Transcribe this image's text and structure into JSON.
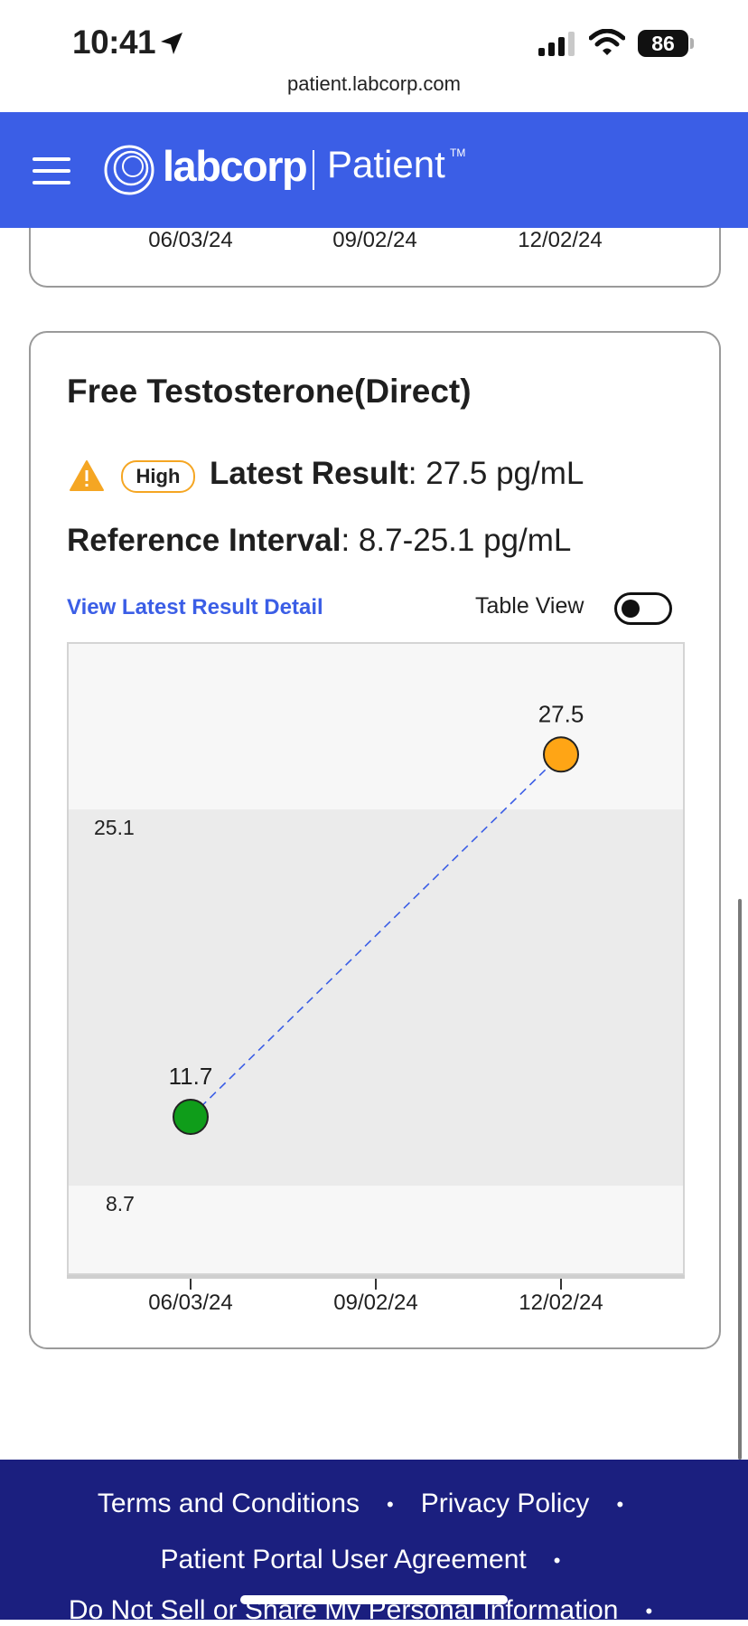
{
  "status_bar": {
    "time": "10:41",
    "battery": "86"
  },
  "browser": {
    "url": "patient.labcorp.com"
  },
  "header": {
    "brand": "labcorp",
    "product": "Patient",
    "trademark": "TM"
  },
  "previous_chart": {
    "x_ticks": [
      "06/03/24",
      "09/02/24",
      "12/02/24"
    ]
  },
  "card": {
    "title": "Free Testosterone(Direct)",
    "badge": "High",
    "latest_label": "Latest Result",
    "latest_value": ": 27.5 pg/mL",
    "ref_label": "Reference Interval",
    "ref_value": ": 8.7-25.1 pg/mL",
    "detail_link": "View Latest Result Detail",
    "table_view_label": "Table View",
    "table_view_on": false
  },
  "chart_data": {
    "type": "line",
    "x": [
      "06/03/24",
      "12/02/24"
    ],
    "y": [
      11.7,
      27.5
    ],
    "x_ticks": [
      "06/03/24",
      "09/02/24",
      "12/02/24"
    ],
    "reference_range": [
      8.7,
      25.1
    ],
    "reference_labels": [
      "25.1",
      "8.7"
    ],
    "data_labels": [
      "11.7",
      "27.5"
    ],
    "point_colors": [
      "#0f9d1a",
      "#ffa515"
    ],
    "line_color": "#3b5ee6",
    "band_color": "#ebebeb",
    "ylim": [
      4.8,
      32.4
    ]
  },
  "footer": {
    "links": [
      "Terms and Conditions",
      "Privacy Policy",
      "Patient Portal User Agreement",
      "Do Not Sell or Share My Personal Information"
    ]
  },
  "colors": {
    "brand_blue": "#3b5ee6",
    "footer_navy": "#1b1f7f",
    "warning": "#f5a623"
  }
}
